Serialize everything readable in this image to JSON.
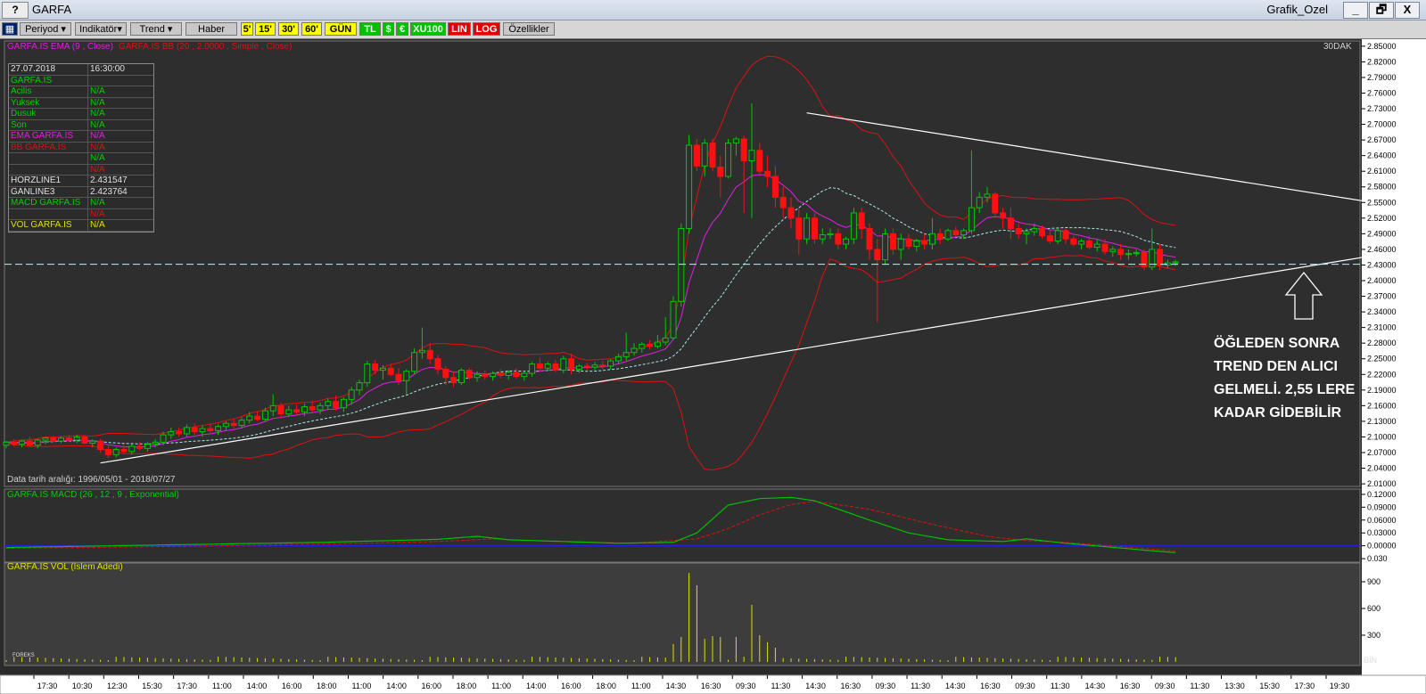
{
  "window": {
    "help_label": "?",
    "title": "GARFA",
    "right_title": "Grafik_Ozel",
    "min_label": "_",
    "restore_label": "🗗",
    "close_label": "X"
  },
  "toolbar": {
    "periyod": "Periyod",
    "indikator": "Indikatör",
    "trend": "Trend",
    "haber": "Haber",
    "b5": "5'",
    "b15": "15'",
    "b30": "30'",
    "b60": "60'",
    "gun": "GÜN",
    "tl": "TL",
    "usd": "$",
    "eur": "€",
    "xu100": "XU100",
    "lin": "LIN",
    "log": "LOG",
    "ozellikler": "Özellikler"
  },
  "colors": {
    "up": "#00c800",
    "down": "#ff1010",
    "ema": "#e020e0",
    "bb": "#e01010",
    "mid": "#a8e8e8",
    "macd": "#00c000",
    "signal": "#e01010",
    "vol": "#e0e000",
    "trend": "#ffffff",
    "label": "#ffffff"
  },
  "info": [
    [
      "27.07.2018",
      "16:30:00"
    ],
    [
      "GARFA.IS",
      ""
    ],
    [
      " Acilis",
      "N/A"
    ],
    [
      " Yuksek",
      "N/A"
    ],
    [
      " Dusuk",
      "N/A"
    ],
    [
      " Son",
      "N/A"
    ],
    [
      "EMA GARFA.IS",
      "N/A"
    ],
    [
      "BB GARFA.IS",
      "N/A"
    ],
    [
      "",
      "N/A"
    ],
    [
      "",
      "N/A"
    ],
    [
      "HORZLINE1",
      "2.431547"
    ],
    [
      "GANLINE3",
      "2.423764"
    ],
    [
      "MACD GARFA.IS",
      "N/A"
    ],
    [
      "",
      "N/A"
    ],
    [
      "VOL GARFA.IS",
      "N/A"
    ]
  ],
  "chart_data": [
    {
      "type": "candlestick",
      "legend": [
        "GARFA.IS EMA (9 , Close)",
        "GARFA.IS BB (20 , 2.0000 , Simple , Close)"
      ],
      "period_label": "30DAK",
      "date_range_label": "Data tarih aralığı: 1996/05/01 - 2018/07/27",
      "ylim": [
        2.005,
        2.86
      ],
      "y_ticks": [
        "2.85000",
        "2.82000",
        "2.79000",
        "2.76000",
        "2.73000",
        "2.70000",
        "2.67000",
        "2.64000",
        "2.61000",
        "2.58000",
        "2.55000",
        "2.52000",
        "2.49000",
        "2.46000",
        "2.43000",
        "2.40000",
        "2.37000",
        "2.34000",
        "2.31000",
        "2.28000",
        "2.25000",
        "2.22000",
        "2.19000",
        "2.16000",
        "2.13000",
        "2.10000",
        "2.07000",
        "2.04000",
        "2.01000"
      ],
      "x_ticks": [
        "17:30",
        "10:30",
        "12:30",
        "15:30",
        "17:30",
        "11:00",
        "14:00",
        "16:00",
        "18:00",
        "11:00",
        "14:00",
        "16:00",
        "18:00",
        "11:00",
        "14:00",
        "16:00",
        "18:00",
        "11:00",
        "14:30",
        "16:30",
        "09:30",
        "11:30",
        "14:30",
        "16:30",
        "09:30",
        "11:30",
        "14:30",
        "16:30",
        "09:30",
        "11:30",
        "14:30",
        "16:30",
        "09:30",
        "11:30",
        "13:30",
        "15:30",
        "17:30",
        "19:30"
      ],
      "candles": [
        [
          2.084,
          2.092,
          2.078,
          2.09
        ],
        [
          2.09,
          2.096,
          2.082,
          2.086
        ],
        [
          2.086,
          2.094,
          2.08,
          2.092
        ],
        [
          2.092,
          2.1,
          2.082,
          2.084
        ],
        [
          2.084,
          2.096,
          2.078,
          2.094
        ],
        [
          2.094,
          2.1,
          2.086,
          2.098
        ],
        [
          2.098,
          2.102,
          2.09,
          2.092
        ],
        [
          2.092,
          2.1,
          2.088,
          2.098
        ],
        [
          2.098,
          2.104,
          2.09,
          2.094
        ],
        [
          2.094,
          2.104,
          2.088,
          2.1
        ],
        [
          2.1,
          2.104,
          2.086,
          2.088
        ],
        [
          2.088,
          2.096,
          2.08,
          2.092
        ],
        [
          2.092,
          2.096,
          2.07,
          2.076
        ],
        [
          2.076,
          2.084,
          2.06,
          2.066
        ],
        [
          2.066,
          2.08,
          2.06,
          2.076
        ],
        [
          2.076,
          2.084,
          2.068,
          2.072
        ],
        [
          2.072,
          2.086,
          2.066,
          2.082
        ],
        [
          2.082,
          2.09,
          2.074,
          2.078
        ],
        [
          2.078,
          2.09,
          2.072,
          2.086
        ],
        [
          2.086,
          2.096,
          2.08,
          2.09
        ],
        [
          2.09,
          2.11,
          2.084,
          2.104
        ],
        [
          2.104,
          2.118,
          2.096,
          2.11
        ],
        [
          2.11,
          2.118,
          2.1,
          2.106
        ],
        [
          2.106,
          2.124,
          2.1,
          2.118
        ],
        [
          2.118,
          2.126,
          2.104,
          2.11
        ],
        [
          2.11,
          2.122,
          2.1,
          2.116
        ],
        [
          2.116,
          2.126,
          2.108,
          2.112
        ],
        [
          2.112,
          2.124,
          2.104,
          2.12
        ],
        [
          2.12,
          2.13,
          2.112,
          2.126
        ],
        [
          2.126,
          2.134,
          2.116,
          2.122
        ],
        [
          2.122,
          2.138,
          2.116,
          2.132
        ],
        [
          2.132,
          2.148,
          2.126,
          2.14
        ],
        [
          2.14,
          2.15,
          2.13,
          2.134
        ],
        [
          2.134,
          2.156,
          2.13,
          2.15
        ],
        [
          2.15,
          2.182,
          2.14,
          2.16
        ],
        [
          2.16,
          2.166,
          2.136,
          2.144
        ],
        [
          2.144,
          2.16,
          2.138,
          2.152
        ],
        [
          2.152,
          2.162,
          2.142,
          2.148
        ],
        [
          2.148,
          2.164,
          2.14,
          2.158
        ],
        [
          2.158,
          2.17,
          2.148,
          2.152
        ],
        [
          2.152,
          2.166,
          2.144,
          2.16
        ],
        [
          2.16,
          2.174,
          2.152,
          2.168
        ],
        [
          2.168,
          2.18,
          2.15,
          2.156
        ],
        [
          2.156,
          2.176,
          2.148,
          2.172
        ],
        [
          2.172,
          2.196,
          2.162,
          2.19
        ],
        [
          2.19,
          2.21,
          2.18,
          2.204
        ],
        [
          2.204,
          2.246,
          2.196,
          2.24
        ],
        [
          2.24,
          2.248,
          2.22,
          2.228
        ],
        [
          2.228,
          2.238,
          2.21,
          2.232
        ],
        [
          2.232,
          2.24,
          2.216,
          2.22
        ],
        [
          2.22,
          2.232,
          2.2,
          2.208
        ],
        [
          2.208,
          2.23,
          2.18,
          2.226
        ],
        [
          2.226,
          2.27,
          2.22,
          2.262
        ],
        [
          2.262,
          2.31,
          2.25,
          2.266
        ],
        [
          2.266,
          2.28,
          2.24,
          2.25
        ],
        [
          2.25,
          2.258,
          2.22,
          2.23
        ],
        [
          2.23,
          2.236,
          2.2,
          2.214
        ],
        [
          2.214,
          2.226,
          2.196,
          2.204
        ],
        [
          2.204,
          2.232,
          2.2,
          2.228
        ],
        [
          2.228,
          2.232,
          2.21,
          2.214
        ],
        [
          2.214,
          2.226,
          2.206,
          2.22
        ],
        [
          2.22,
          2.228,
          2.21,
          2.216
        ],
        [
          2.216,
          2.226,
          2.208,
          2.222
        ],
        [
          2.222,
          2.23,
          2.212,
          2.218
        ],
        [
          2.218,
          2.228,
          2.21,
          2.224
        ],
        [
          2.224,
          2.232,
          2.212,
          2.216
        ],
        [
          2.216,
          2.226,
          2.208,
          2.222
        ],
        [
          2.222,
          2.244,
          2.216,
          2.24
        ],
        [
          2.24,
          2.252,
          2.226,
          2.232
        ],
        [
          2.232,
          2.244,
          2.226,
          2.24
        ],
        [
          2.24,
          2.248,
          2.224,
          2.228
        ],
        [
          2.228,
          2.256,
          2.222,
          2.25
        ],
        [
          2.25,
          2.26,
          2.22,
          2.23
        ],
        [
          2.23,
          2.24,
          2.222,
          2.236
        ],
        [
          2.236,
          2.242,
          2.228,
          2.234
        ],
        [
          2.234,
          2.244,
          2.228,
          2.238
        ],
        [
          2.238,
          2.246,
          2.23,
          2.236
        ],
        [
          2.236,
          2.25,
          2.23,
          2.246
        ],
        [
          2.246,
          2.26,
          2.24,
          2.254
        ],
        [
          2.254,
          2.3,
          2.246,
          2.262
        ],
        [
          2.262,
          2.28,
          2.256,
          2.27
        ],
        [
          2.27,
          2.282,
          2.262,
          2.278
        ],
        [
          2.278,
          2.286,
          2.268,
          2.274
        ],
        [
          2.274,
          2.296,
          2.27,
          2.282
        ],
        [
          2.282,
          2.33,
          2.276,
          2.29
        ],
        [
          2.29,
          2.37,
          2.286,
          2.36
        ],
        [
          2.36,
          2.51,
          2.35,
          2.5
        ],
        [
          2.5,
          2.68,
          2.49,
          2.66
        ],
        [
          2.66,
          2.672,
          2.61,
          2.62
        ],
        [
          2.62,
          2.672,
          2.6,
          2.664
        ],
        [
          2.664,
          2.672,
          2.61,
          2.618
        ],
        [
          2.618,
          2.64,
          2.56,
          2.6
        ],
        [
          2.6,
          2.672,
          2.596,
          2.664
        ],
        [
          2.664,
          2.676,
          2.64,
          2.672
        ],
        [
          2.672,
          2.678,
          2.53,
          2.63
        ],
        [
          2.63,
          2.74,
          2.52,
          2.65
        ],
        [
          2.65,
          2.664,
          2.6,
          2.61
        ],
        [
          2.61,
          2.64,
          2.58,
          2.6
        ],
        [
          2.6,
          2.62,
          2.54,
          2.56
        ],
        [
          2.56,
          2.58,
          2.52,
          2.54
        ],
        [
          2.54,
          2.56,
          2.5,
          2.52
        ],
        [
          2.52,
          2.54,
          2.45,
          2.48
        ],
        [
          2.48,
          2.53,
          2.47,
          2.52
        ],
        [
          2.52,
          2.53,
          2.47,
          2.48
        ],
        [
          2.48,
          2.5,
          2.47,
          2.488
        ],
        [
          2.488,
          2.5,
          2.48,
          2.49
        ],
        [
          2.49,
          2.5,
          2.46,
          2.47
        ],
        [
          2.47,
          2.484,
          2.46,
          2.48
        ],
        [
          2.48,
          2.54,
          2.47,
          2.53
        ],
        [
          2.53,
          2.54,
          2.48,
          2.5
        ],
        [
          2.5,
          2.51,
          2.44,
          2.46
        ],
        [
          2.46,
          2.48,
          2.32,
          2.44
        ],
        [
          2.44,
          2.5,
          2.43,
          2.49
        ],
        [
          2.49,
          2.5,
          2.45,
          2.46
        ],
        [
          2.46,
          2.49,
          2.44,
          2.48
        ],
        [
          2.48,
          2.49,
          2.46,
          2.466
        ],
        [
          2.466,
          2.48,
          2.456,
          2.476
        ],
        [
          2.476,
          2.49,
          2.46,
          2.47
        ],
        [
          2.47,
          2.52,
          2.46,
          2.49
        ],
        [
          2.49,
          2.5,
          2.47,
          2.48
        ],
        [
          2.48,
          2.5,
          2.476,
          2.496
        ],
        [
          2.496,
          2.504,
          2.484,
          2.488
        ],
        [
          2.488,
          2.5,
          2.48,
          2.496
        ],
        [
          2.496,
          2.65,
          2.49,
          2.54
        ],
        [
          2.54,
          2.57,
          2.53,
          2.56
        ],
        [
          2.56,
          2.58,
          2.55,
          2.566
        ],
        [
          2.566,
          2.57,
          2.52,
          2.53
        ],
        [
          2.53,
          2.54,
          2.5,
          2.52
        ],
        [
          2.52,
          2.54,
          2.48,
          2.5
        ],
        [
          2.5,
          2.51,
          2.48,
          2.49
        ],
        [
          2.49,
          2.5,
          2.47,
          2.494
        ],
        [
          2.494,
          2.51,
          2.486,
          2.5
        ],
        [
          2.5,
          2.506,
          2.48,
          2.486
        ],
        [
          2.486,
          2.5,
          2.47,
          2.476
        ],
        [
          2.476,
          2.5,
          2.47,
          2.496
        ],
        [
          2.496,
          2.5,
          2.47,
          2.48
        ],
        [
          2.48,
          2.486,
          2.466,
          2.47
        ],
        [
          2.47,
          2.48,
          2.46,
          2.476
        ],
        [
          2.476,
          2.486,
          2.46,
          2.464
        ],
        [
          2.464,
          2.48,
          2.456,
          2.47
        ],
        [
          2.47,
          2.48,
          2.45,
          2.456
        ],
        [
          2.456,
          2.466,
          2.446,
          2.46
        ],
        [
          2.46,
          2.47,
          2.44,
          2.45
        ],
        [
          2.45,
          2.46,
          2.44,
          2.452
        ],
        [
          2.452,
          2.46,
          2.446,
          2.454
        ],
        [
          2.454,
          2.46,
          2.42,
          2.426
        ],
        [
          2.426,
          2.5,
          2.42,
          2.46
        ],
        [
          2.46,
          2.47,
          2.42,
          2.43
        ],
        [
          2.43,
          2.44,
          2.424,
          2.434
        ],
        [
          2.434,
          2.44,
          2.428,
          2.436
        ]
      ],
      "trend_lines": [
        {
          "from": [
            12,
            2.05
          ],
          "to": [
            175,
            2.45
          ]
        },
        {
          "from": [
            102,
            2.722
          ],
          "to": [
            175,
            2.548
          ]
        }
      ],
      "horizontal_line": 2.4315,
      "annotation": [
        "ÖĞLEDEN SONRA",
        "TREND DEN ALICI",
        "GELMELİ. 2,55 LERE",
        "KADAR GİDEBİLİR"
      ]
    },
    {
      "type": "line",
      "legend": "GARFA.IS MACD (26 , 12 , 9 , Exponential)",
      "ylim": [
        -0.034,
        0.126
      ],
      "y_ticks": [
        "0.12000",
        "0.09000",
        "0.06000",
        "0.03000",
        "0.00000",
        "0.030"
      ],
      "macd_anchors": [
        [
          0,
          -0.004
        ],
        [
          20,
          0.002
        ],
        [
          40,
          0.008
        ],
        [
          55,
          0.015
        ],
        [
          60,
          0.022
        ],
        [
          64,
          0.014
        ],
        [
          78,
          0.006
        ],
        [
          85,
          0.008
        ],
        [
          88,
          0.03
        ],
        [
          92,
          0.095
        ],
        [
          96,
          0.11
        ],
        [
          100,
          0.113
        ],
        [
          103,
          0.105
        ],
        [
          110,
          0.06
        ],
        [
          115,
          0.03
        ],
        [
          120,
          0.014
        ],
        [
          127,
          0.01
        ],
        [
          130,
          0.016
        ],
        [
          135,
          0.006
        ],
        [
          140,
          -0.002
        ],
        [
          145,
          -0.01
        ],
        [
          149,
          -0.016
        ]
      ],
      "signal_anchors": [
        [
          0,
          -0.006
        ],
        [
          20,
          -0.002
        ],
        [
          40,
          0.004
        ],
        [
          55,
          0.01
        ],
        [
          62,
          0.016
        ],
        [
          70,
          0.01
        ],
        [
          80,
          0.006
        ],
        [
          88,
          0.016
        ],
        [
          92,
          0.04
        ],
        [
          96,
          0.072
        ],
        [
          100,
          0.096
        ],
        [
          103,
          0.104
        ],
        [
          110,
          0.085
        ],
        [
          118,
          0.05
        ],
        [
          125,
          0.022
        ],
        [
          130,
          0.012
        ],
        [
          135,
          0.008
        ],
        [
          140,
          0.001
        ],
        [
          149,
          -0.012
        ]
      ]
    },
    {
      "type": "bar",
      "legend": "GARFA.IS VOL (Islem Adedi)",
      "ylim": [
        0,
        1090
      ],
      "y_ticks": [
        "900",
        "600",
        "300"
      ],
      "spikes": [
        [
          85,
          200
        ],
        [
          86,
          280
        ],
        [
          87,
          1000
        ],
        [
          88,
          860
        ],
        [
          89,
          260
        ],
        [
          90,
          290
        ],
        [
          91,
          280
        ],
        [
          93,
          280
        ],
        [
          95,
          640
        ],
        [
          96,
          300
        ],
        [
          97,
          220
        ],
        [
          98,
          160
        ]
      ]
    }
  ],
  "y_axis_unit_label": "BİN",
  "logo_text": "FOREKS"
}
